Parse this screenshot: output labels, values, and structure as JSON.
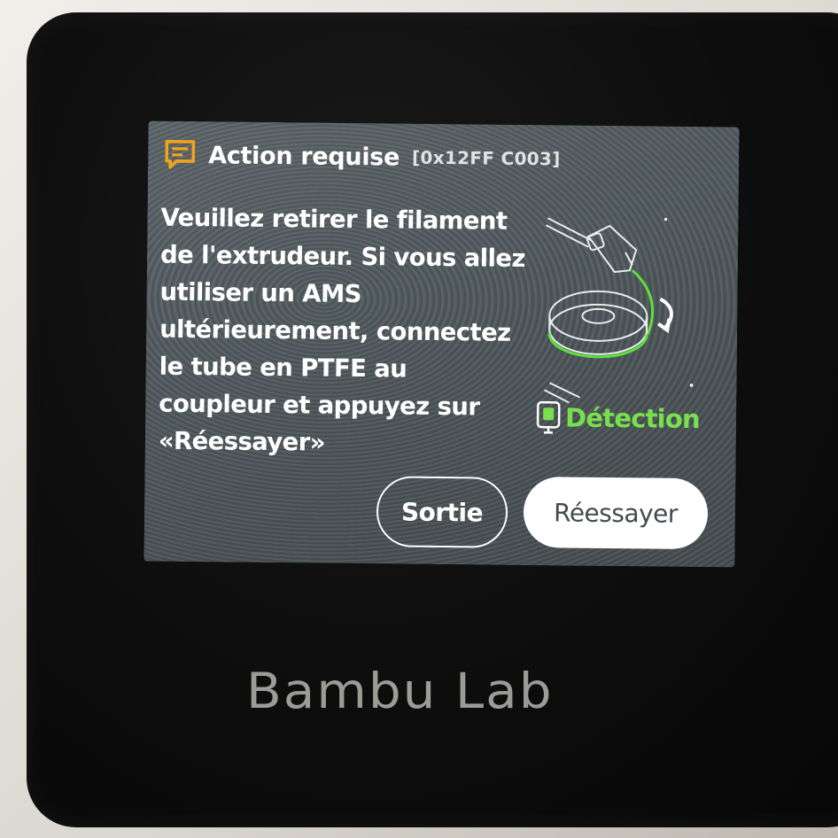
{
  "dialog": {
    "title": "Action requise",
    "error_code": "[0x12FF C003]",
    "message": "Veuillez retirer le filament\nde l'extrudeur. Si vous allez\nutiliser un AMS\nultérieurement, connectez\nle tube en PTFE au\ncoupleur et appuyez sur\n«Réessayer»",
    "detection_label": "Détection",
    "detection_status_color": "#78e04e",
    "exit_button_label": "Sortie",
    "retry_button_label": "Réessayer",
    "icons": {
      "header": "message-alert-icon",
      "detection": "filament-sensor-icon",
      "illustration": "extruder-spool-illustration"
    },
    "accent_color": "#f2a51a"
  },
  "device": {
    "brand_logo": "Bambu Lab"
  }
}
